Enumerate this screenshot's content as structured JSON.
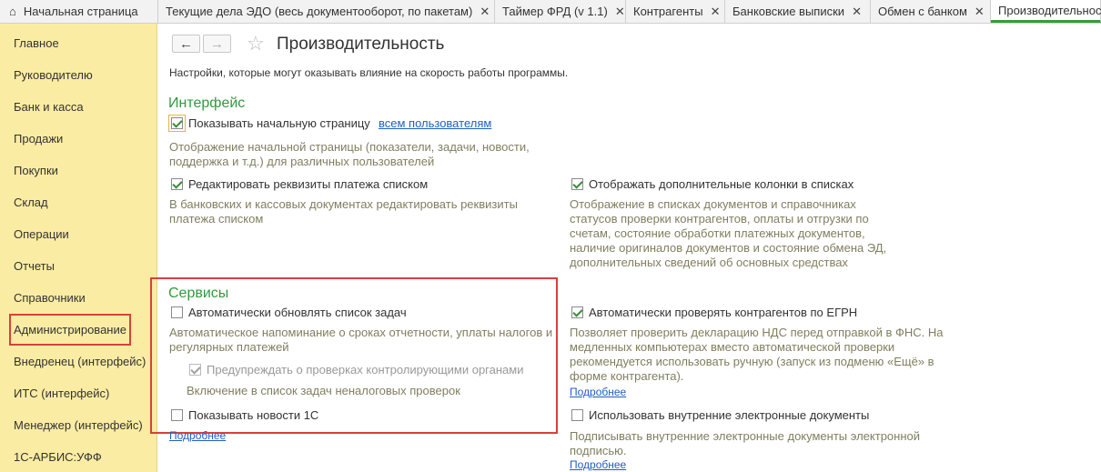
{
  "tabs": {
    "home": "Начальная страница",
    "t1": "Текущие дела ЭДО (весь документооборот, по пакетам)",
    "t2": "Таймер ФРД (v 1.1)",
    "t3": "Контрагенты",
    "t4": "Банковские выписки",
    "t5": "Обмен с банком",
    "t6": "Производительность"
  },
  "sidebar": [
    "Главное",
    "Руководителю",
    "Банк и касса",
    "Продажи",
    "Покупки",
    "Склад",
    "Операции",
    "Отчеты",
    "Справочники",
    "Администрирование",
    "Внедренец (интерфейс)",
    "ИТС (интерфейс)",
    "Менеджер (интерфейс)",
    "1С-АРБИС:УФФ"
  ],
  "page": {
    "title": "Производительность",
    "subtitle": "Настройки, которые могут оказывать влияние на скорость работы программы."
  },
  "interface": {
    "heading": "Интерфейс",
    "show_start": "Показывать начальную страницу",
    "all_users": "всем пользователям",
    "show_start_desc": "Отображение начальной страницы (показатели, задачи, новости, поддержка и т.д.) для различных пользователей",
    "edit_req": "Редактировать реквизиты платежа списком",
    "edit_req_desc": "В банковских и кассовых документах редактировать реквизиты платежа списком",
    "extra_cols": "Отображать дополнительные колонки в списках",
    "extra_cols_desc": "Отображение в списках документов и справочниках статусов проверки контрагентов, оплаты и отгрузки по счетам, состояние обработки платежных документов, наличие оригиналов документов и состояние обмена ЭД, дополнительных сведений об основных средствах"
  },
  "services": {
    "heading": "Сервисы",
    "auto_tasks": "Автоматически обновлять список задач",
    "auto_tasks_desc": "Автоматическое напоминание о сроках отчетности, уплаты налогов и регулярных платежей",
    "warn_checks": "Предупреждать о проверках контролирующими органами",
    "warn_checks_desc": "Включение в список задач неналоговых проверок",
    "show_news": "Показывать новости 1С",
    "more": "Подробнее",
    "auto_egrn": "Автоматически проверять контрагентов по ЕГРН",
    "auto_egrn_desc": "Позволяет проверить декларацию НДС перед отправкой в ФНС. На медленных компьютерах вместо автоматической проверки рекомендуется использовать ручную (запуск из подменю «Ещё» в форме контрагента).",
    "more2": "Подробнее",
    "internal_docs": "Использовать внутренние электронные документы",
    "internal_docs_desc": "Подписывать внутренние электронные документы электронной подписью.",
    "more3": "Подробнее"
  }
}
